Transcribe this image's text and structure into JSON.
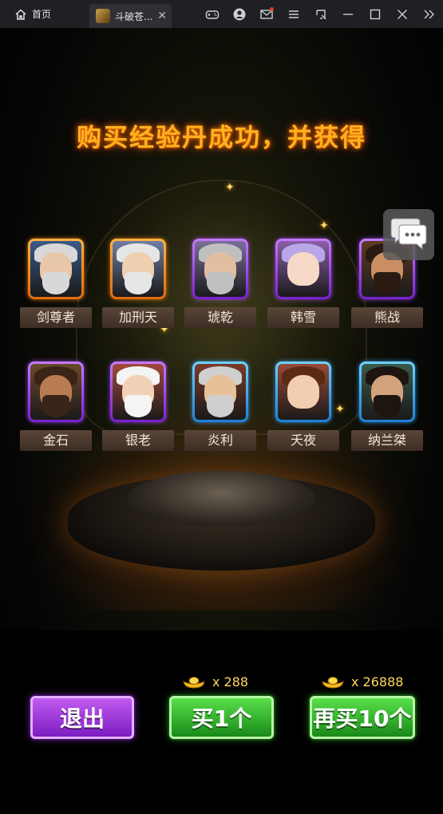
{
  "browser": {
    "home_tab_label": "首页",
    "game_tab_label": "斗破苍...",
    "close_icon": "close-icon",
    "toolbar_icons": [
      "gamepad-icon",
      "user-icon",
      "mail-icon",
      "menu-icon",
      "screenshot-icon",
      "minimize-icon",
      "maximize-icon",
      "close-window-icon",
      "collapse-icon"
    ]
  },
  "game": {
    "title": "购买经验丹成功，并获得",
    "heroes": [
      {
        "name": "剑尊者",
        "rarity": "orange"
      },
      {
        "name": "加刑天",
        "rarity": "orange"
      },
      {
        "name": "琥乾",
        "rarity": "purple"
      },
      {
        "name": "韩雪",
        "rarity": "purple"
      },
      {
        "name": "熊战",
        "rarity": "purple"
      },
      {
        "name": "金石",
        "rarity": "purple"
      },
      {
        "name": "银老",
        "rarity": "purple"
      },
      {
        "name": "炎利",
        "rarity": "blue"
      },
      {
        "name": "夭夜",
        "rarity": "blue"
      },
      {
        "name": "纳兰桀",
        "rarity": "blue"
      }
    ],
    "price_single": "x 288",
    "price_ten": "x 26888",
    "exit_label": "退出",
    "buy_one_label": "买1个",
    "buy_ten_label": "再买10个",
    "colors": {
      "title": "#ffb21e",
      "orange_frame": "#f08a1c",
      "purple_frame": "#a24be8",
      "blue_frame": "#3ea8f0",
      "gold_text": "#ffd85a"
    }
  }
}
